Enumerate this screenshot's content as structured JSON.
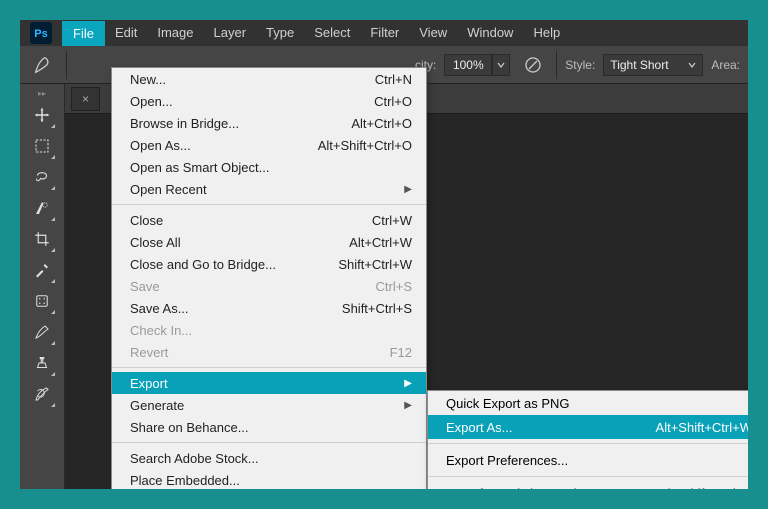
{
  "menubar": {
    "items": [
      "File",
      "Edit",
      "Image",
      "Layer",
      "Type",
      "Select",
      "Filter",
      "View",
      "Window",
      "Help"
    ],
    "open_index": 0
  },
  "options_bar": {
    "opacity_label": "city:",
    "opacity_value": "100%",
    "style_label": "Style:",
    "style_value": "Tight Short",
    "area_label": "Area:"
  },
  "document_tab": {
    "close_glyph": "×"
  },
  "tools": [
    "move-tool",
    "rectangular-marquee-tool",
    "lasso-tool",
    "quick-selection-tool",
    "crop-tool",
    "eyedropper-tool",
    "healing-brush-tool",
    "brush-tool",
    "clone-stamp-tool",
    "history-brush-tool"
  ],
  "file_menu": {
    "groups": [
      [
        {
          "label": "New...",
          "shortcut": "Ctrl+N"
        },
        {
          "label": "Open...",
          "shortcut": "Ctrl+O"
        },
        {
          "label": "Browse in Bridge...",
          "shortcut": "Alt+Ctrl+O"
        },
        {
          "label": "Open As...",
          "shortcut": "Alt+Shift+Ctrl+O"
        },
        {
          "label": "Open as Smart Object...",
          "shortcut": ""
        },
        {
          "label": "Open Recent",
          "shortcut": "",
          "submenu": true
        }
      ],
      [
        {
          "label": "Close",
          "shortcut": "Ctrl+W"
        },
        {
          "label": "Close All",
          "shortcut": "Alt+Ctrl+W"
        },
        {
          "label": "Close and Go to Bridge...",
          "shortcut": "Shift+Ctrl+W"
        },
        {
          "label": "Save",
          "shortcut": "Ctrl+S",
          "disabled": true
        },
        {
          "label": "Save As...",
          "shortcut": "Shift+Ctrl+S"
        },
        {
          "label": "Check In...",
          "shortcut": "",
          "disabled": true
        },
        {
          "label": "Revert",
          "shortcut": "F12",
          "disabled": true
        }
      ],
      [
        {
          "label": "Export",
          "shortcut": "",
          "submenu": true,
          "highlight": true
        },
        {
          "label": "Generate",
          "shortcut": "",
          "submenu": true
        },
        {
          "label": "Share on Behance...",
          "shortcut": ""
        }
      ],
      [
        {
          "label": "Search Adobe Stock...",
          "shortcut": ""
        },
        {
          "label": "Place Embedded...",
          "shortcut": ""
        }
      ]
    ]
  },
  "export_submenu": {
    "groups": [
      [
        {
          "label": "Quick Export as PNG",
          "shortcut": ""
        },
        {
          "label": "Export As...",
          "shortcut": "Alt+Shift+Ctrl+W",
          "highlight": true
        }
      ],
      [
        {
          "label": "Export Preferences...",
          "shortcut": ""
        }
      ],
      [
        {
          "label": "Save for Web (Legacy)...",
          "shortcut": "Alt+Shift+Ctrl+S"
        }
      ]
    ]
  }
}
